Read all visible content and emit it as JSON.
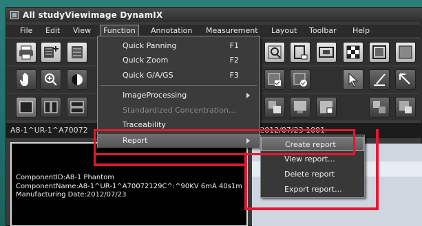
{
  "window": {
    "title": "All studyViewimage DynamIX"
  },
  "menubar": {
    "items": [
      {
        "label": "File"
      },
      {
        "label": "Edit"
      },
      {
        "label": "View"
      },
      {
        "label": "Function"
      },
      {
        "label": "Annotation"
      },
      {
        "label": "Measurement"
      },
      {
        "label": "Layout"
      },
      {
        "label": "Toolbar"
      },
      {
        "label": "Help"
      }
    ]
  },
  "function_menu": {
    "items": [
      {
        "label": "Quick Panning",
        "shortcut": "F1"
      },
      {
        "label": "Quick Zoom",
        "shortcut": "F2"
      },
      {
        "label": "Quick G/A/GS",
        "shortcut": "F3"
      },
      {
        "label": "ImageProcessing"
      },
      {
        "label": "Standardized Concentration..."
      },
      {
        "label": "Traceability"
      },
      {
        "label": "Report"
      }
    ]
  },
  "report_submenu": {
    "items": [
      {
        "label": "Create report"
      },
      {
        "label": "View report..."
      },
      {
        "label": "Delete report"
      },
      {
        "label": "Export report..."
      }
    ]
  },
  "status": {
    "left": "A8-1^UR-1^A70072",
    "right": "m 2012/07/23 1001"
  },
  "viewer": {
    "lines": [
      "ComponentID:A8-1 Phantom",
      "ComponentName:A8-1^UR-1^A70072129C^:^90KV 6mA 40s1m",
      "Manufacturing Date:2012/07/23"
    ]
  },
  "colors": {
    "highlight_outline": "#e3192f",
    "frame": "#1f6f6a"
  }
}
